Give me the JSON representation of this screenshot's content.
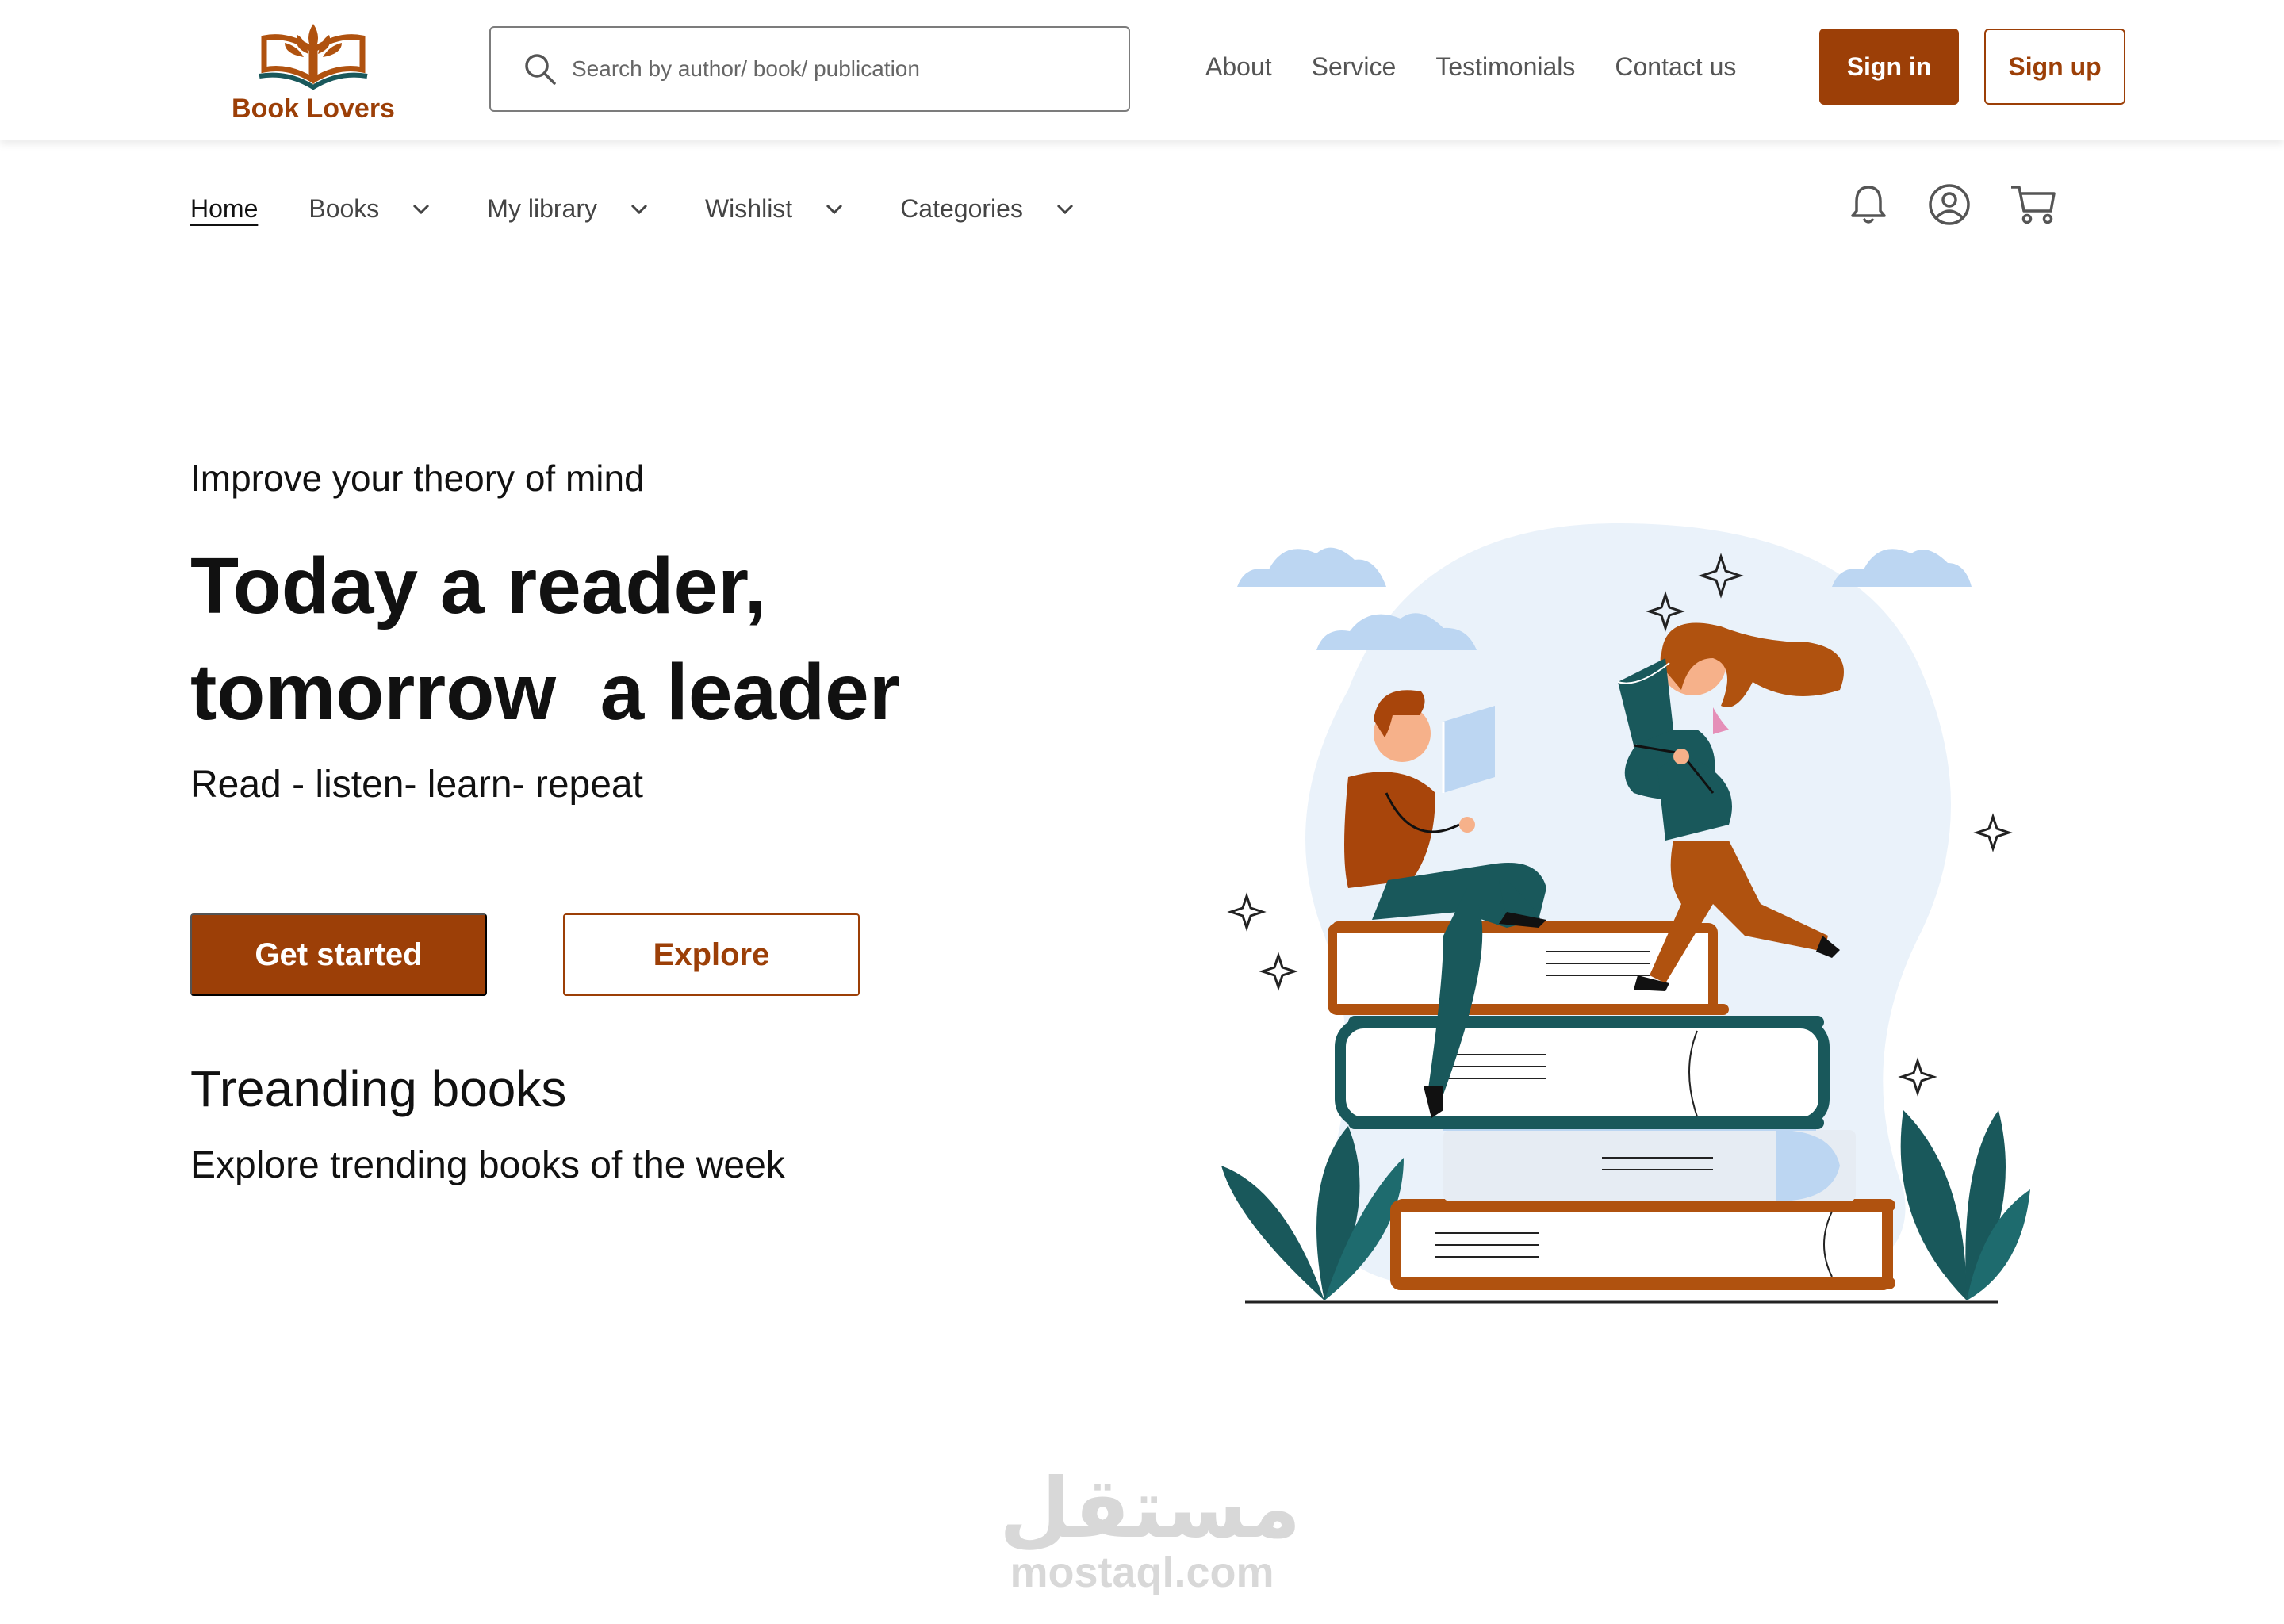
{
  "header": {
    "brand": "Book Lovers",
    "search_placeholder": "Search by author/ book/ publication",
    "links": [
      "About",
      "Service",
      "Testimonials",
      "Contact us"
    ],
    "signin_label": "Sign in",
    "signup_label": "Sign up"
  },
  "nav": {
    "home": "Home",
    "books": "Books",
    "library": "My library",
    "wishlist": "Wishlist",
    "categories": "Categories"
  },
  "hero": {
    "eyebrow": "Improve your theory of mind",
    "title_line1": "Today a reader,",
    "title_line2": "tomorrow  a leader",
    "tagline": "Read - listen- learn- repeat",
    "primary_cta": "Get started",
    "secondary_cta": "Explore"
  },
  "trending": {
    "title": "Treanding books",
    "subtitle": "Explore trending books of the week"
  },
  "watermark": {
    "arabic": "مستقل",
    "latin": "mostaql.com"
  },
  "colors": {
    "brand": "#9c3f07",
    "teal": "#19585b",
    "light_blue": "#bcd6f2",
    "bg_blob": "#eaf2fa"
  },
  "icons": [
    "search-icon",
    "chevron-down-icon",
    "bell-icon",
    "user-icon",
    "cart-icon",
    "open-book-logo-icon"
  ]
}
